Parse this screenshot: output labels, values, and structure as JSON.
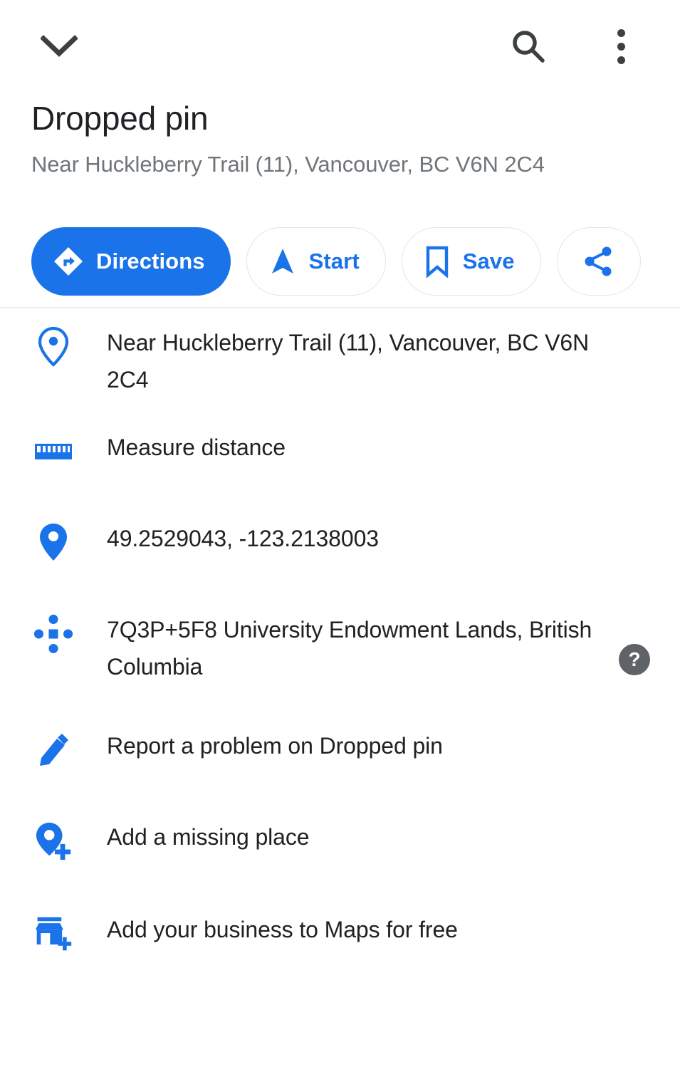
{
  "appbar": {
    "collapse_icon": "chevron-down-icon",
    "search_icon": "search-icon",
    "overflow_icon": "more-vert-icon"
  },
  "header": {
    "title": "Dropped pin",
    "subtitle": "Near Huckleberry Trail (11), Vancouver, BC V6N 2C4"
  },
  "colors": {
    "accent_blue": "#1a73e8",
    "text_primary": "#202124",
    "text_secondary": "#70757a",
    "icon_dark": "#3c4043",
    "help_gray": "#5f6368",
    "divider": "#eceef0",
    "chip_border": "#e3e5e8"
  },
  "actions": [
    {
      "label": "Directions",
      "icon": "directions-icon",
      "style": "primary"
    },
    {
      "label": "Start",
      "icon": "navigation-arrow-icon",
      "style": "outline"
    },
    {
      "label": "Save",
      "icon": "bookmark-icon",
      "style": "outline"
    },
    {
      "label": "",
      "icon": "share-icon",
      "style": "icon-only"
    }
  ],
  "list": [
    {
      "id": "address",
      "icon": "location-pin-outline-icon",
      "text": "Near Huckleberry Trail (11), Vancouver, BC V6N 2C4",
      "has_help": false
    },
    {
      "id": "measure-distance",
      "icon": "ruler-icon",
      "text": "Measure distance",
      "has_help": false
    },
    {
      "id": "coordinates",
      "icon": "location-pin-filled-icon",
      "text": "49.2529043, -123.2138003",
      "has_help": false
    },
    {
      "id": "plus-code",
      "icon": "plus-code-icon",
      "text": "7Q3P+5F8 University Endowment Lands, British Columbia",
      "has_help": true,
      "help_label": "?"
    },
    {
      "id": "report-problem",
      "icon": "pencil-icon",
      "text": "Report a problem on Dropped pin",
      "has_help": false
    },
    {
      "id": "add-missing-place",
      "icon": "add-location-icon",
      "text": "Add a missing place",
      "has_help": false
    },
    {
      "id": "add-business",
      "icon": "add-business-icon",
      "text": "Add your business to Maps for free",
      "has_help": false
    }
  ]
}
